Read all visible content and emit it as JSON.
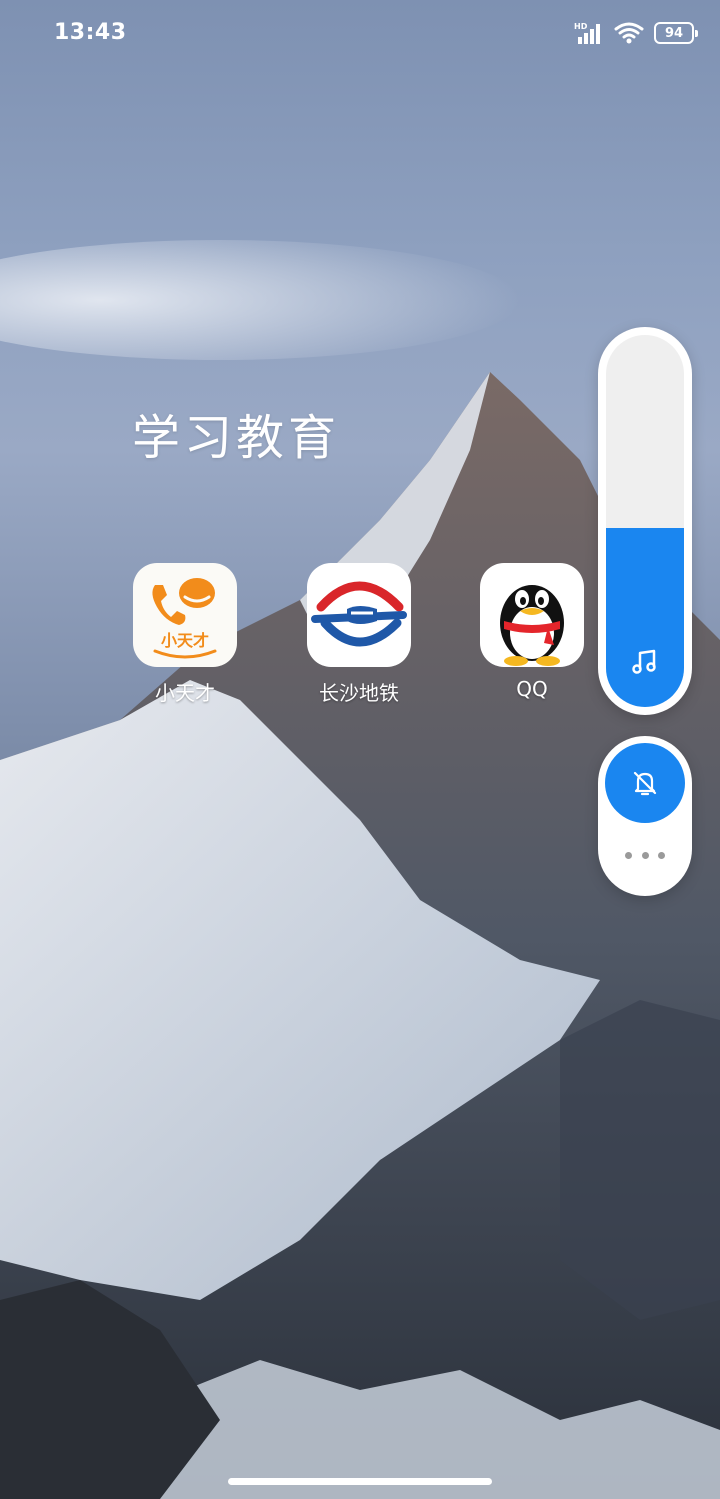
{
  "status_bar": {
    "time": "13:43",
    "network_label": "HD",
    "battery_level": "94"
  },
  "folder": {
    "title": "学习教育",
    "apps": [
      {
        "label": "小天才",
        "icon": "xiaotiancai-app-icon",
        "icon_text": "小天才"
      },
      {
        "label": "长沙地铁",
        "icon": "changsha-metro-app-icon"
      },
      {
        "label": "QQ",
        "icon": "qq-penguin-app-icon"
      }
    ]
  },
  "volume_panel": {
    "level_fraction": 0.48,
    "icon": "music-note-icon",
    "accent_color": "#1a86f0",
    "mute_icon": "bell-off-icon",
    "more_icon": "more-dots-icon"
  },
  "wallpaper": {
    "subject": "mountain-peak-icon"
  }
}
